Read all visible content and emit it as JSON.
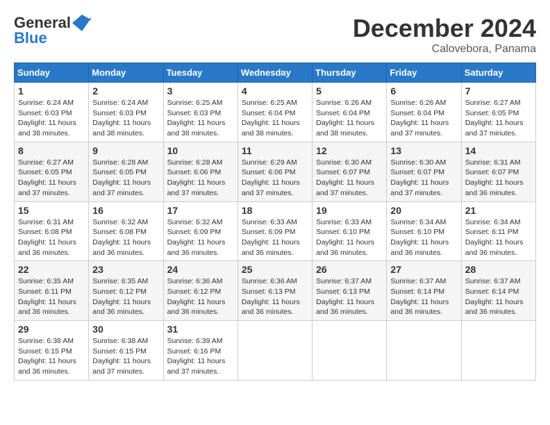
{
  "header": {
    "logo_general": "General",
    "logo_blue": "Blue",
    "month_title": "December 2024",
    "location": "Calovebora, Panama"
  },
  "weekdays": [
    "Sunday",
    "Monday",
    "Tuesday",
    "Wednesday",
    "Thursday",
    "Friday",
    "Saturday"
  ],
  "weeks": [
    [
      {
        "day": "1",
        "info": "Sunrise: 6:24 AM\nSunset: 6:03 PM\nDaylight: 11 hours\nand 38 minutes."
      },
      {
        "day": "2",
        "info": "Sunrise: 6:24 AM\nSunset: 6:03 PM\nDaylight: 11 hours\nand 38 minutes."
      },
      {
        "day": "3",
        "info": "Sunrise: 6:25 AM\nSunset: 6:03 PM\nDaylight: 11 hours\nand 38 minutes."
      },
      {
        "day": "4",
        "info": "Sunrise: 6:25 AM\nSunset: 6:04 PM\nDaylight: 11 hours\nand 38 minutes."
      },
      {
        "day": "5",
        "info": "Sunrise: 6:26 AM\nSunset: 6:04 PM\nDaylight: 11 hours\nand 38 minutes."
      },
      {
        "day": "6",
        "info": "Sunrise: 6:26 AM\nSunset: 6:04 PM\nDaylight: 11 hours\nand 37 minutes."
      },
      {
        "day": "7",
        "info": "Sunrise: 6:27 AM\nSunset: 6:05 PM\nDaylight: 11 hours\nand 37 minutes."
      }
    ],
    [
      {
        "day": "8",
        "info": "Sunrise: 6:27 AM\nSunset: 6:05 PM\nDaylight: 11 hours\nand 37 minutes."
      },
      {
        "day": "9",
        "info": "Sunrise: 6:28 AM\nSunset: 6:05 PM\nDaylight: 11 hours\nand 37 minutes."
      },
      {
        "day": "10",
        "info": "Sunrise: 6:28 AM\nSunset: 6:06 PM\nDaylight: 11 hours\nand 37 minutes."
      },
      {
        "day": "11",
        "info": "Sunrise: 6:29 AM\nSunset: 6:06 PM\nDaylight: 11 hours\nand 37 minutes."
      },
      {
        "day": "12",
        "info": "Sunrise: 6:30 AM\nSunset: 6:07 PM\nDaylight: 11 hours\nand 37 minutes."
      },
      {
        "day": "13",
        "info": "Sunrise: 6:30 AM\nSunset: 6:07 PM\nDaylight: 11 hours\nand 37 minutes."
      },
      {
        "day": "14",
        "info": "Sunrise: 6:31 AM\nSunset: 6:07 PM\nDaylight: 11 hours\nand 36 minutes."
      }
    ],
    [
      {
        "day": "15",
        "info": "Sunrise: 6:31 AM\nSunset: 6:08 PM\nDaylight: 11 hours\nand 36 minutes."
      },
      {
        "day": "16",
        "info": "Sunrise: 6:32 AM\nSunset: 6:08 PM\nDaylight: 11 hours\nand 36 minutes."
      },
      {
        "day": "17",
        "info": "Sunrise: 6:32 AM\nSunset: 6:09 PM\nDaylight: 11 hours\nand 36 minutes."
      },
      {
        "day": "18",
        "info": "Sunrise: 6:33 AM\nSunset: 6:09 PM\nDaylight: 11 hours\nand 36 minutes."
      },
      {
        "day": "19",
        "info": "Sunrise: 6:33 AM\nSunset: 6:10 PM\nDaylight: 11 hours\nand 36 minutes."
      },
      {
        "day": "20",
        "info": "Sunrise: 6:34 AM\nSunset: 6:10 PM\nDaylight: 11 hours\nand 36 minutes."
      },
      {
        "day": "21",
        "info": "Sunrise: 6:34 AM\nSunset: 6:11 PM\nDaylight: 11 hours\nand 36 minutes."
      }
    ],
    [
      {
        "day": "22",
        "info": "Sunrise: 6:35 AM\nSunset: 6:11 PM\nDaylight: 11 hours\nand 36 minutes."
      },
      {
        "day": "23",
        "info": "Sunrise: 6:35 AM\nSunset: 6:12 PM\nDaylight: 11 hours\nand 36 minutes."
      },
      {
        "day": "24",
        "info": "Sunrise: 6:36 AM\nSunset: 6:12 PM\nDaylight: 11 hours\nand 36 minutes."
      },
      {
        "day": "25",
        "info": "Sunrise: 6:36 AM\nSunset: 6:13 PM\nDaylight: 11 hours\nand 36 minutes."
      },
      {
        "day": "26",
        "info": "Sunrise: 6:37 AM\nSunset: 6:13 PM\nDaylight: 11 hours\nand 36 minutes."
      },
      {
        "day": "27",
        "info": "Sunrise: 6:37 AM\nSunset: 6:14 PM\nDaylight: 11 hours\nand 36 minutes."
      },
      {
        "day": "28",
        "info": "Sunrise: 6:37 AM\nSunset: 6:14 PM\nDaylight: 11 hours\nand 36 minutes."
      }
    ],
    [
      {
        "day": "29",
        "info": "Sunrise: 6:38 AM\nSunset: 6:15 PM\nDaylight: 11 hours\nand 36 minutes."
      },
      {
        "day": "30",
        "info": "Sunrise: 6:38 AM\nSunset: 6:15 PM\nDaylight: 11 hours\nand 37 minutes."
      },
      {
        "day": "31",
        "info": "Sunrise: 6:39 AM\nSunset: 6:16 PM\nDaylight: 11 hours\nand 37 minutes."
      },
      {
        "day": "",
        "info": ""
      },
      {
        "day": "",
        "info": ""
      },
      {
        "day": "",
        "info": ""
      },
      {
        "day": "",
        "info": ""
      }
    ]
  ]
}
